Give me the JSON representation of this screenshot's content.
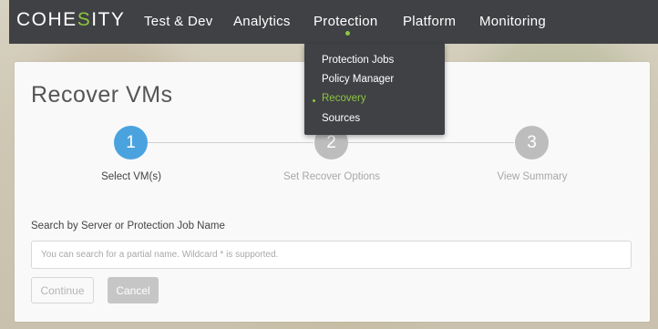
{
  "brand": {
    "logo_prefix": "COHE",
    "logo_accent": "S",
    "logo_suffix": "ITY",
    "accent_color": "#8cc63f"
  },
  "nav": {
    "items": [
      {
        "label": "Test & Dev"
      },
      {
        "label": "Analytics"
      },
      {
        "label": "Protection"
      },
      {
        "label": "Platform"
      },
      {
        "label": "Monitoring"
      }
    ],
    "active": "Protection"
  },
  "dropdown": {
    "items": [
      {
        "label": "Protection Jobs"
      },
      {
        "label": "Policy Manager"
      },
      {
        "label": "Recovery"
      },
      {
        "label": "Sources"
      }
    ],
    "active": "Recovery"
  },
  "page": {
    "title": "Recover VMs"
  },
  "wizard": {
    "steps": [
      {
        "number": "1",
        "label": "Select VM(s)",
        "state": "active"
      },
      {
        "number": "2",
        "label": "Set Recover Options",
        "state": "inactive"
      },
      {
        "number": "3",
        "label": "View Summary",
        "state": "inactive"
      }
    ],
    "active_color": "#4aa3df",
    "inactive_color": "#bdbdbd"
  },
  "search": {
    "label": "Search by Server or Protection Job Name",
    "placeholder": "You can search for a partial name. Wildcard * is supported.",
    "value": ""
  },
  "actions": {
    "continue_label": "Continue",
    "cancel_label": "Cancel"
  }
}
